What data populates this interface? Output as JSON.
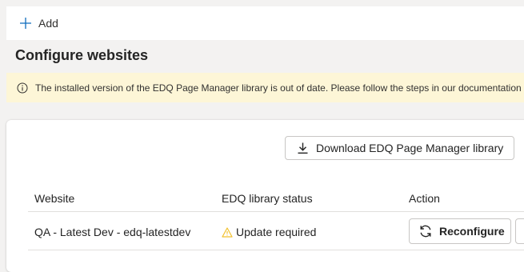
{
  "toolbar": {
    "add_label": "Add",
    "add_icon": "plus-icon"
  },
  "page": {
    "title": "Configure websites"
  },
  "banner": {
    "icon": "info-icon",
    "text": "The installed version of the EDQ Page Manager library is out of date. Please follow the steps in our documentation fo"
  },
  "card": {
    "download_label": "Download EDQ Page Manager library",
    "download_icon": "download-icon",
    "table": {
      "columns": [
        "Website",
        "EDQ library status",
        "Action"
      ],
      "rows": [
        {
          "website": "QA - Latest Dev - edq-latestdev",
          "status": "Update required",
          "status_icon": "warning-icon",
          "status_color": "#f2c12e",
          "action_label": "Reconfigure",
          "action_icon": "refresh-icon"
        }
      ]
    }
  },
  "colors": {
    "accent": "#0f6cbd",
    "banner_bg": "#fdf6d7"
  }
}
